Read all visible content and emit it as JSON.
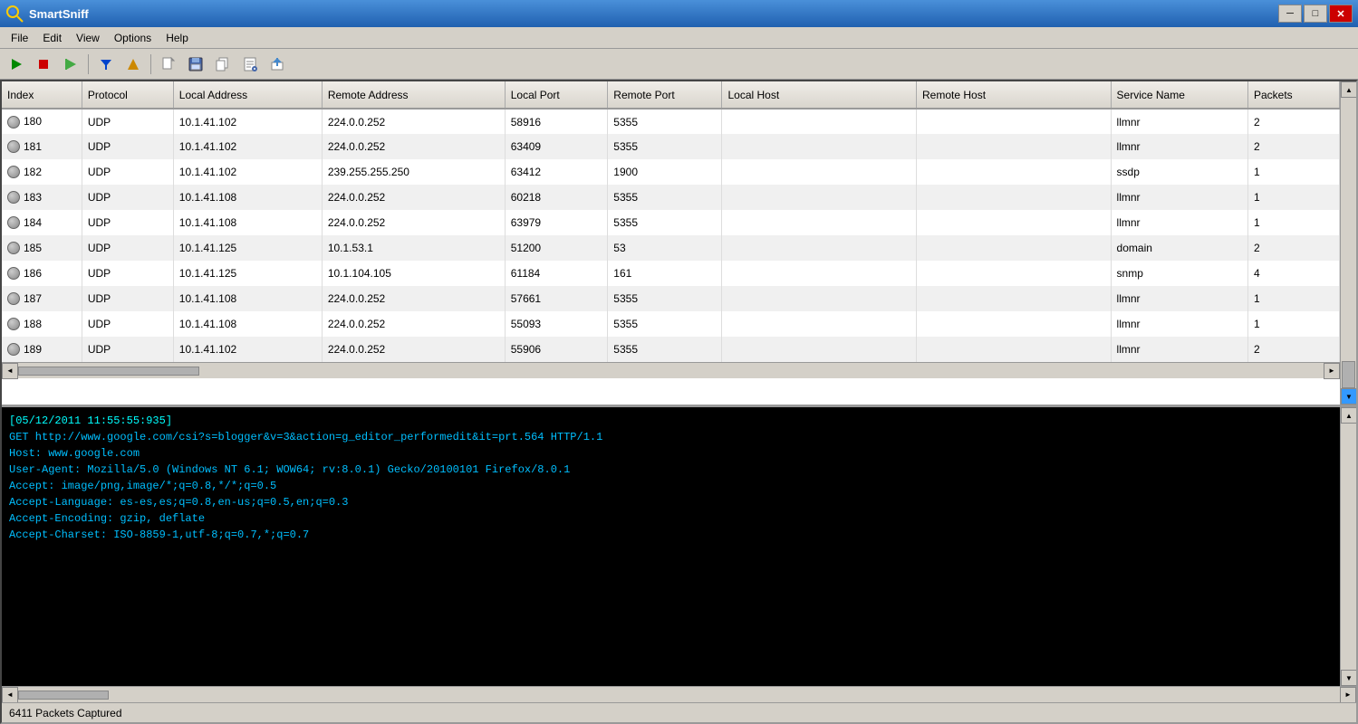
{
  "app": {
    "title": "SmartSniff",
    "icon": "🔍"
  },
  "titlebar": {
    "min_label": "─",
    "max_label": "□",
    "close_label": "✕"
  },
  "menu": {
    "items": [
      "File",
      "Edit",
      "View",
      "Options",
      "Help"
    ]
  },
  "toolbar": {
    "buttons": [
      {
        "name": "play",
        "icon": "▶",
        "label": "Start Capture"
      },
      {
        "name": "stop",
        "icon": "■",
        "label": "Stop Capture"
      },
      {
        "name": "play-green",
        "icon": "▶",
        "label": "Play"
      },
      {
        "name": "filter",
        "icon": "▼",
        "label": "Filter"
      },
      {
        "name": "alert",
        "icon": "▲",
        "label": "Alert"
      },
      {
        "name": "new",
        "icon": "📄",
        "label": "New"
      },
      {
        "name": "save",
        "icon": "💾",
        "label": "Save"
      },
      {
        "name": "copy",
        "icon": "📋",
        "label": "Copy"
      },
      {
        "name": "paste",
        "icon": "📌",
        "label": "Paste"
      },
      {
        "name": "export",
        "icon": "📤",
        "label": "Export"
      }
    ]
  },
  "table": {
    "columns": [
      "Index",
      "Protocol",
      "Local Address",
      "Remote Address",
      "Local Port",
      "Remote Port",
      "Local Host",
      "Remote Host",
      "Service Name",
      "Packets"
    ],
    "rows": [
      {
        "index": "180",
        "protocol": "UDP",
        "local_addr": "10.1.41.102",
        "remote_addr": "224.0.0.252",
        "local_port": "58916",
        "remote_port": "5355",
        "local_host": "",
        "remote_host": "",
        "service": "llmnr",
        "packets": "2"
      },
      {
        "index": "181",
        "protocol": "UDP",
        "local_addr": "10.1.41.102",
        "remote_addr": "224.0.0.252",
        "local_port": "63409",
        "remote_port": "5355",
        "local_host": "",
        "remote_host": "",
        "service": "llmnr",
        "packets": "2"
      },
      {
        "index": "182",
        "protocol": "UDP",
        "local_addr": "10.1.41.102",
        "remote_addr": "239.255.255.250",
        "local_port": "63412",
        "remote_port": "1900",
        "local_host": "",
        "remote_host": "",
        "service": "ssdp",
        "packets": "1"
      },
      {
        "index": "183",
        "protocol": "UDP",
        "local_addr": "10.1.41.108",
        "remote_addr": "224.0.0.252",
        "local_port": "60218",
        "remote_port": "5355",
        "local_host": "",
        "remote_host": "",
        "service": "llmnr",
        "packets": "1"
      },
      {
        "index": "184",
        "protocol": "UDP",
        "local_addr": "10.1.41.108",
        "remote_addr": "224.0.0.252",
        "local_port": "63979",
        "remote_port": "5355",
        "local_host": "",
        "remote_host": "",
        "service": "llmnr",
        "packets": "1"
      },
      {
        "index": "185",
        "protocol": "UDP",
        "local_addr": "10.1.41.125",
        "remote_addr": "10.1.53.1",
        "local_port": "51200",
        "remote_port": "53",
        "local_host": "",
        "remote_host": "",
        "service": "domain",
        "packets": "2"
      },
      {
        "index": "186",
        "protocol": "UDP",
        "local_addr": "10.1.41.125",
        "remote_addr": "10.1.104.105",
        "local_port": "61184",
        "remote_port": "161",
        "local_host": "",
        "remote_host": "",
        "service": "snmp",
        "packets": "4"
      },
      {
        "index": "187",
        "protocol": "UDP",
        "local_addr": "10.1.41.108",
        "remote_addr": "224.0.0.252",
        "local_port": "57661",
        "remote_port": "5355",
        "local_host": "",
        "remote_host": "",
        "service": "llmnr",
        "packets": "1"
      },
      {
        "index": "188",
        "protocol": "UDP",
        "local_addr": "10.1.41.108",
        "remote_addr": "224.0.0.252",
        "local_port": "55093",
        "remote_port": "5355",
        "local_host": "",
        "remote_host": "",
        "service": "llmnr",
        "packets": "1"
      },
      {
        "index": "189",
        "protocol": "UDP",
        "local_addr": "10.1.41.102",
        "remote_addr": "224.0.0.252",
        "local_port": "55906",
        "remote_port": "5355",
        "local_host": "",
        "remote_host": "",
        "service": "llmnr",
        "packets": "2"
      }
    ]
  },
  "lower_panel": {
    "lines": [
      "[05/12/2011 11:55:55:935]",
      "GET http://www.google.com/csi?s=blogger&v=3&action=g_editor_performedit&it=prt.564 HTTP/1.1",
      "Host: www.google.com",
      "User-Agent: Mozilla/5.0 (Windows NT 6.1; WOW64; rv:8.0.1) Gecko/20100101 Firefox/8.0.1",
      "Accept: image/png,image/*;q=0.8,*/*;q=0.5",
      "Accept-Language: es-es,es;q=0.8,en-us;q=0.5,en;q=0.3",
      "Accept-Encoding: gzip, deflate",
      "Accept-Charset: ISO-8859-1,utf-8;q=0.7,*;q=0.7"
    ]
  },
  "status_bar": {
    "text": "6411 Packets Captured"
  }
}
